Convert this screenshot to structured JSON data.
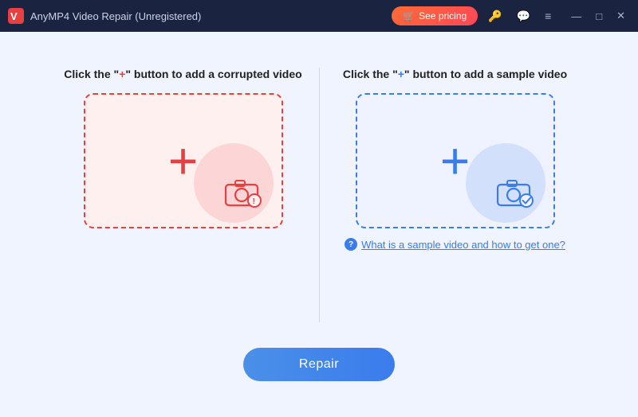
{
  "titleBar": {
    "logo": "anymp4-logo",
    "title": "AnyMP4 Video Repair (Unregistered)",
    "seePricingLabel": "See pricing",
    "icons": {
      "key": "🔑",
      "chat": "💬",
      "menu": "≡",
      "minimize": "—",
      "maximize": "□",
      "close": "✕"
    }
  },
  "leftPanel": {
    "instructionPrefix": "Click the \"",
    "instructionPlus": "+",
    "instructionSuffix": "\" button to add a corrupted video",
    "addLabel": "+",
    "zoneType": "corrupted"
  },
  "rightPanel": {
    "instructionPrefix": "Click the \"",
    "instructionPlus": "+",
    "instructionSuffix": "\" button to add a sample video",
    "addLabel": "+",
    "zoneType": "sample",
    "helpText": "What is a sample video and how to get one?"
  },
  "repairButton": {
    "label": "Repair"
  }
}
